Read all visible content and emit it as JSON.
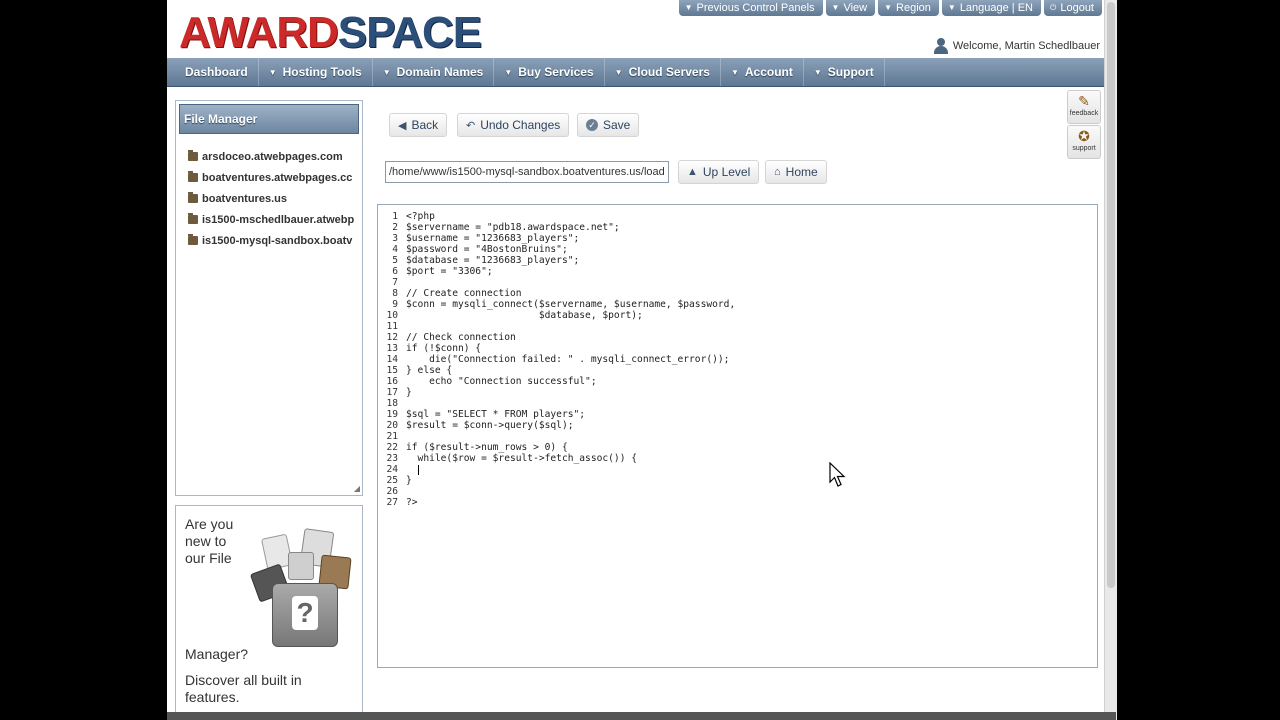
{
  "logo": {
    "part1": "AWARD",
    "part2": "SPACE"
  },
  "top_links": [
    {
      "label": "Previous Control Panels"
    },
    {
      "label": "View"
    },
    {
      "label": "Region"
    },
    {
      "label": "Language | EN"
    },
    {
      "label": "Logout"
    }
  ],
  "welcome": "Welcome, Martin Schedlbauer",
  "nav": [
    {
      "label": "Dashboard"
    },
    {
      "label": "Hosting Tools"
    },
    {
      "label": "Domain Names"
    },
    {
      "label": "Buy Services"
    },
    {
      "label": "Cloud Servers"
    },
    {
      "label": "Account"
    },
    {
      "label": "Support"
    }
  ],
  "file_manager": {
    "title": "File Manager",
    "items": [
      {
        "label": "arsdoceo.atwebpages.com"
      },
      {
        "label": "boatventures.atwebpages.cc"
      },
      {
        "label": "boatventures.us"
      },
      {
        "label": "is1500-mschedlbauer.atwebp"
      },
      {
        "label": "is1500-mysql-sandbox.boatv"
      }
    ]
  },
  "promo": {
    "line1": "Are you",
    "line2": "new to",
    "line3": "our File",
    "line4": "Manager?",
    "line5": "Discover all built in",
    "line6": "features."
  },
  "toolbar": {
    "back": "Back",
    "undo": "Undo Changes",
    "save": "Save"
  },
  "pathbar": {
    "value": "/home/www/is1500-mysql-sandbox.boatventures.us/load",
    "up_level": "Up Level",
    "home": "Home"
  },
  "side_icons": {
    "feedback": "feedback",
    "support": "support"
  },
  "editor": {
    "lines": [
      {
        "n": "1",
        "t": "<?php"
      },
      {
        "n": "2",
        "t": "$servername = \"pdb18.awardspace.net\";"
      },
      {
        "n": "3",
        "t": "$username = \"1236683_players\";"
      },
      {
        "n": "4",
        "t": "$password = \"4BostonBruins\";"
      },
      {
        "n": "5",
        "t": "$database = \"1236683_players\";"
      },
      {
        "n": "6",
        "t": "$port = \"3306\";"
      },
      {
        "n": "7",
        "t": ""
      },
      {
        "n": "8",
        "t": "// Create connection"
      },
      {
        "n": "9",
        "t": "$conn = mysqli_connect($servername, $username, $password,"
      },
      {
        "n": "10",
        "t": "                       $database, $port);"
      },
      {
        "n": "11",
        "t": ""
      },
      {
        "n": "12",
        "t": "// Check connection"
      },
      {
        "n": "13",
        "t": "if (!$conn) {"
      },
      {
        "n": "14",
        "t": "    die(\"Connection failed: \" . mysqli_connect_error());"
      },
      {
        "n": "15",
        "t": "} else {"
      },
      {
        "n": "16",
        "t": "    echo \"Connection successful\";"
      },
      {
        "n": "17",
        "t": "}"
      },
      {
        "n": "18",
        "t": ""
      },
      {
        "n": "19",
        "t": "$sql = \"SELECT * FROM players\";"
      },
      {
        "n": "20",
        "t": "$result = $conn->query($sql);"
      },
      {
        "n": "21",
        "t": ""
      },
      {
        "n": "22",
        "t": "if ($result->num_rows > 0) {"
      },
      {
        "n": "23",
        "t": "  while($row = $result->fetch_assoc()) {"
      },
      {
        "n": "24",
        "t": ""
      },
      {
        "n": "25",
        "t": "}"
      },
      {
        "n": "26",
        "t": ""
      },
      {
        "n": "27",
        "t": "?>"
      }
    ]
  }
}
